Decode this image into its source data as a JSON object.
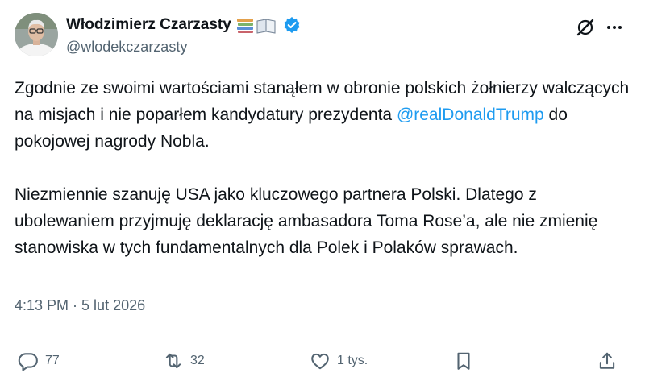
{
  "author": {
    "display_name": "Włodzimierz Czarzasty",
    "name_emoji": "📚📖",
    "handle": "@wlodekczarzasty",
    "avatar_icon": "profile-photo-avatar",
    "verified_icon": "verified-badge-icon",
    "verified_color": "#1d9bf0"
  },
  "header_actions": {
    "grok_icon": "grok-icon",
    "more_icon": "more-dots-icon"
  },
  "tweet": {
    "paragraph_1": {
      "text_before": "Zgodnie ze swoimi wartościami stanąłem w obronie polskich żołnierzy walczących na misjach i nie poparłem kandydatury prezydenta ",
      "mention": "@realDonaldTrump",
      "text_after": " do pokojowej nagrody Nobla."
    },
    "paragraph_2": "Niezmiennie szanuję USA jako kluczowego partnera Polski. Dlatego z ubolewaniem przyjmuję deklarację ambasadora Toma Rose’a, ale nie zmienię stanowiska w tych fundamentalnych dla Polek i Polaków sprawach.",
    "mention_color": "#1d9bf0"
  },
  "meta": {
    "time": "4:13 PM",
    "separator": "·",
    "date": "5 lut 2026"
  },
  "actions": {
    "reply": {
      "icon": "reply-icon",
      "count": "77"
    },
    "retweet": {
      "icon": "retweet-icon",
      "count": "32"
    },
    "like": {
      "icon": "heart-icon",
      "count": "1 tys."
    },
    "bookmark": {
      "icon": "bookmark-icon"
    },
    "share": {
      "icon": "share-icon"
    }
  }
}
